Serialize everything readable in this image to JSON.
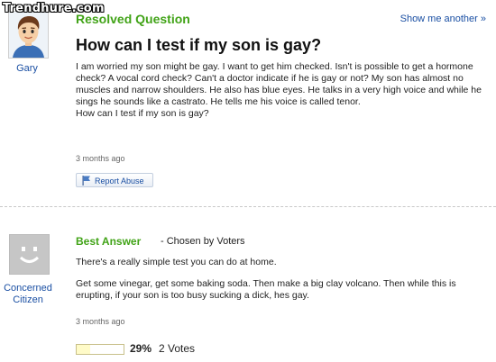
{
  "watermark": "Trendhure.com",
  "question": {
    "status": "Resolved Question",
    "show_more": "Show me another »",
    "asker_name": "Gary",
    "title": "How can I test if my son is gay?",
    "body": "I am worried my son might be gay. I want to get him checked. Isn't is possible to get a hormone check? A vocal cord check? Can't a doctor indicate if he is gay or not? My son has almost no muscles and narrow shoulders. He also has blue eyes. He talks in a very high voice and while he sings he sounds like a castrato. He tells me his voice is called tenor.",
    "body_last_line": "How can I test if my son is gay?",
    "timestamp": "3 months ago",
    "report_label": "Report Abuse"
  },
  "answer": {
    "best_label": "Best Answer",
    "chosen_label": "- Chosen by Voters",
    "answerer_name_line1": "Concerned",
    "answerer_name_line2": "Citizen",
    "paragraph1": "There's a really simple test you can do at home.",
    "paragraph2": "Get some vinegar, get some baking soda. Then make a big clay volcano. Then while this is erupting, if your son is too busy sucking a dick, hes gay.",
    "timestamp": "3 months ago",
    "vote_percent_label": "29%",
    "vote_percent_value": 0.29,
    "vote_count": "2 Votes"
  },
  "icons": {
    "avatar": "cartoon-boy-avatar",
    "anon_avatar": "anonymous-smiley-avatar",
    "report": "flag-icon"
  },
  "colors": {
    "green_heading": "#41a317",
    "link_blue": "#1a4fa3"
  }
}
